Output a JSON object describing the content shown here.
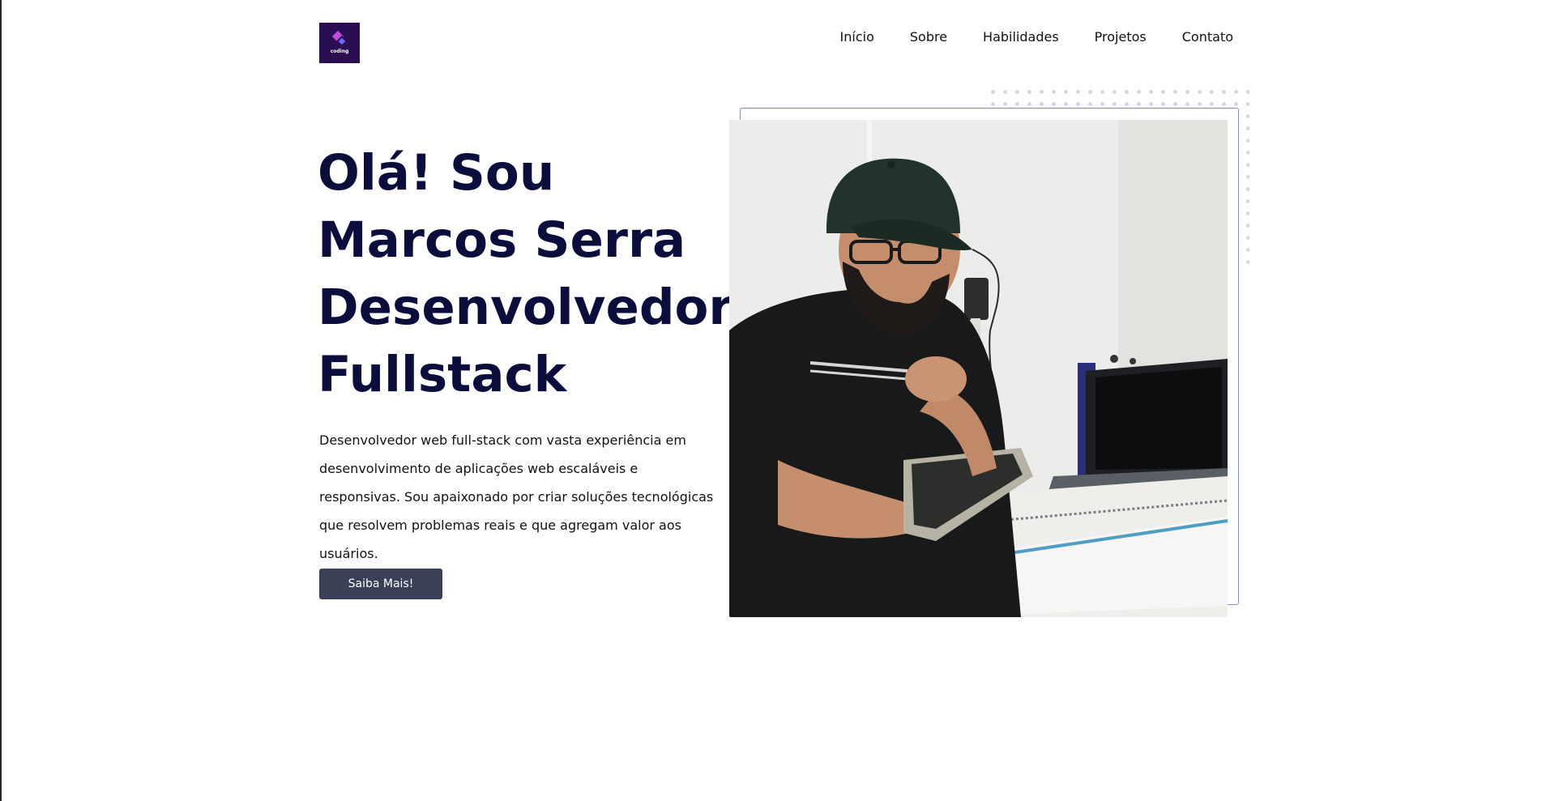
{
  "logo": {
    "text": "coding",
    "colors": {
      "bg": "#2b0d52",
      "accent1": "#c04bdc",
      "accent2": "#6b6ff0"
    }
  },
  "nav": {
    "items": [
      "Início",
      "Sobre",
      "Habilidades",
      "Projetos",
      "Contato"
    ]
  },
  "hero": {
    "title_lines": [
      "Olá! Sou",
      "Marcos Serra",
      "Desenvolvedor",
      "Fullstack"
    ],
    "description": "Desenvolvedor web full-stack com vasta experiência em desenvolvimento de aplicações web escaláveis e responsivas. Sou apaixonado por criar soluções tecnológicas que resolvem problemas reais e que agregam valor aos usuários.",
    "cta_label": "Saiba Mais!"
  },
  "photo": {
    "subject": "man-in-cap-holding-tablet-at-desk"
  },
  "colors": {
    "title": "#0b0d3d",
    "button": "#3a4058",
    "frame": "#7d8ee0"
  }
}
